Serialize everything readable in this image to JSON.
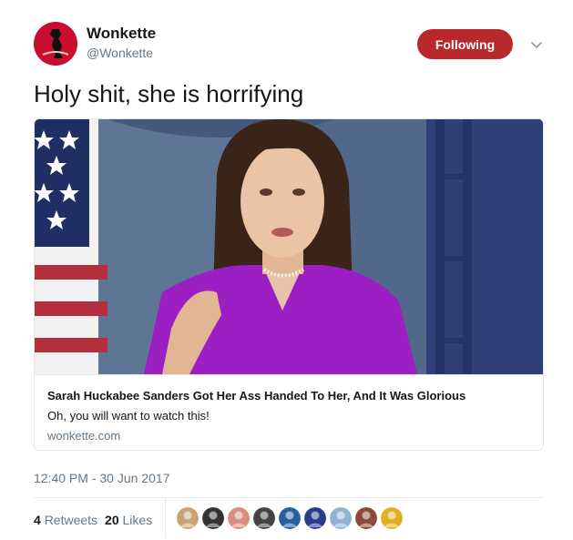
{
  "author": {
    "display_name": "Wonkette",
    "handle": "@Wonkette",
    "avatar_icon": "wonkette-logo-icon",
    "brand_color": "#c8102e"
  },
  "follow_button": {
    "label": "Following",
    "color": "#b8282d"
  },
  "menu": {
    "icon": "chevron-down-icon"
  },
  "tweet": {
    "text": "Holy shit, she is horrifying"
  },
  "card": {
    "title": "Sarah Huckabee Sanders Got Her Ass Handed To Her, And It Was Glorious",
    "description": "Oh, you will want to watch this!",
    "domain": "wonkette.com"
  },
  "timestamp": "12:40 PM - 30 Jun 2017",
  "stats": {
    "retweets_count": "4",
    "retweets_label": "Retweets",
    "likes_count": "20",
    "likes_label": "Likes"
  },
  "likers": [
    {
      "icon": "user-avatar-icon",
      "color": "#c9a27a"
    },
    {
      "icon": "user-avatar-icon",
      "color": "#333333"
    },
    {
      "icon": "user-avatar-icon",
      "color": "#d98e7f"
    },
    {
      "icon": "user-avatar-icon",
      "color": "#444444"
    },
    {
      "icon": "user-avatar-icon",
      "color": "#2a5f9e"
    },
    {
      "icon": "user-avatar-icon",
      "color": "#2b3a8c"
    },
    {
      "icon": "user-avatar-icon",
      "color": "#8fb3d4"
    },
    {
      "icon": "user-avatar-icon",
      "color": "#8b4a3c"
    },
    {
      "icon": "user-avatar-icon",
      "color": "#e0b020"
    }
  ]
}
